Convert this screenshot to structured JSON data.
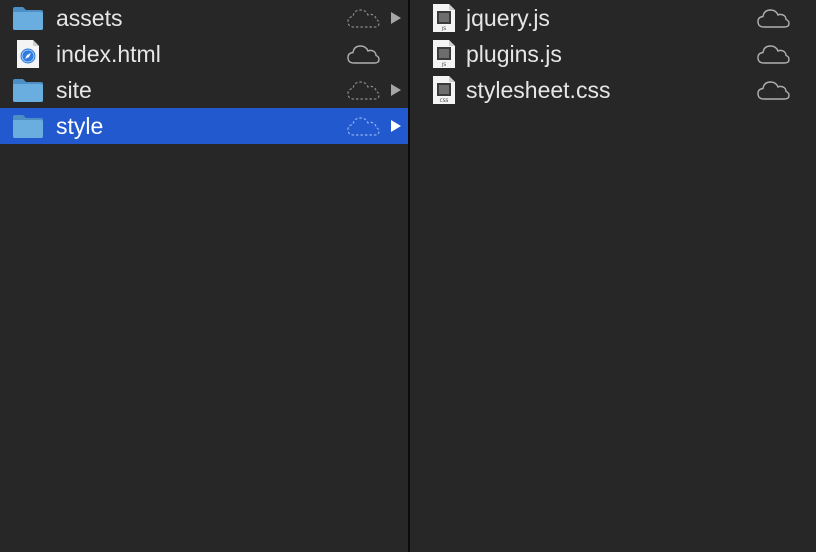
{
  "columns": {
    "left": {
      "items": [
        {
          "name": "assets",
          "kind": "folder",
          "cloud": "cloud-dashed-icon",
          "selected": false,
          "has_children": true
        },
        {
          "name": "index.html",
          "kind": "html-file",
          "cloud": "cloud-icon",
          "selected": false,
          "has_children": false
        },
        {
          "name": "site",
          "kind": "folder",
          "cloud": "cloud-dashed-icon",
          "selected": false,
          "has_children": true
        },
        {
          "name": "style",
          "kind": "folder",
          "cloud": "cloud-dashed-icon",
          "selected": true,
          "has_children": true
        }
      ]
    },
    "right": {
      "items": [
        {
          "name": "jquery.js",
          "kind": "js-file",
          "badge": "JS",
          "cloud": "cloud-icon"
        },
        {
          "name": "plugins.js",
          "kind": "js-file",
          "badge": "JS",
          "cloud": "cloud-icon"
        },
        {
          "name": "stylesheet.css",
          "kind": "css-file",
          "badge": "CSS",
          "cloud": "cloud-icon"
        }
      ]
    }
  },
  "colors": {
    "background": "#272727",
    "selection": "#2259cf",
    "text": "#e6e6e6",
    "folder": "#63a4d6"
  }
}
